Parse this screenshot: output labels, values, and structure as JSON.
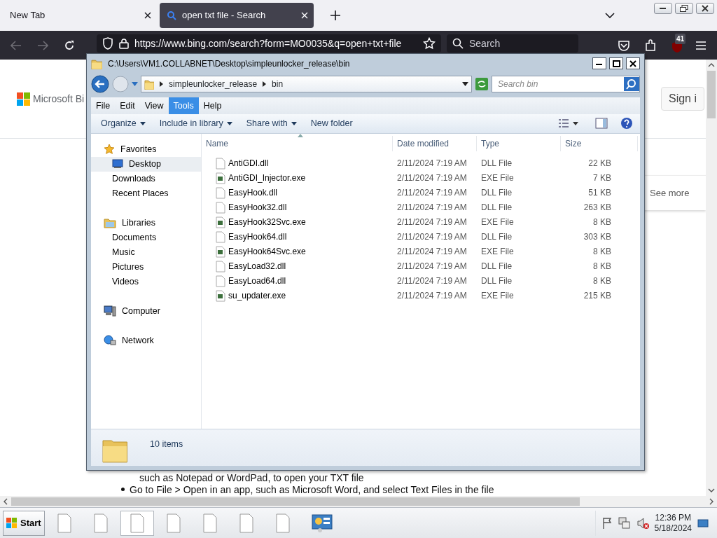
{
  "browser": {
    "tabs": [
      {
        "label": "New Tab",
        "kind": "blank",
        "selected": false
      },
      {
        "label": "open txt file - Search",
        "kind": "search",
        "selected": true
      }
    ],
    "back": {
      "disabled": true
    },
    "forward": {
      "disabled": true
    },
    "url": "https://www.bing.com/search?form=MO0035&q=open+txt+file",
    "search": {
      "placeholder": "Search"
    },
    "extension_badge": "41"
  },
  "page": {
    "logo": "Microsoft Bi",
    "sign_in": "Sign i",
    "see_more": "See more",
    "paragraphs": [
      {
        "text": "such as Notepad or WordPad, to open your TXT file",
        "bullet": false
      },
      {
        "text": "Go to File > Open in an app, such as Microsoft Word, and select Text Files in the file",
        "bullet": true
      }
    ]
  },
  "explorer": {
    "title": "C:\\Users\\VM1.COLLABNET\\Desktop\\simpleunlocker_release\\bin",
    "breadcrumb": [
      "simpleunlocker_release",
      "bin"
    ],
    "search": {
      "placeholder": "Search bin"
    },
    "menu": [
      {
        "label": "File",
        "selected": false
      },
      {
        "label": "Edit",
        "selected": false
      },
      {
        "label": "View",
        "selected": false
      },
      {
        "label": "Tools",
        "selected": true
      },
      {
        "label": "Help",
        "selected": false
      }
    ],
    "commands": [
      {
        "label": "Organize",
        "dropdown": true
      },
      {
        "label": "Include in library",
        "dropdown": true
      },
      {
        "label": "Share with",
        "dropdown": true
      },
      {
        "label": "New folder",
        "dropdown": false
      }
    ],
    "nav": [
      {
        "label": "Favorites",
        "kind": "favorites",
        "selected": false,
        "children": [
          {
            "label": "Desktop",
            "kind": "desktop",
            "selected": true
          },
          {
            "label": "Downloads",
            "kind": "plain",
            "selected": false
          },
          {
            "label": "Recent Places",
            "kind": "plain",
            "selected": false
          }
        ]
      },
      {
        "label": "Libraries",
        "kind": "libraries",
        "selected": false,
        "children": [
          {
            "label": "Documents",
            "kind": "plain",
            "selected": false
          },
          {
            "label": "Music",
            "kind": "plain",
            "selected": false
          },
          {
            "label": "Pictures",
            "kind": "plain",
            "selected": false
          },
          {
            "label": "Videos",
            "kind": "plain",
            "selected": false
          }
        ]
      },
      {
        "label": "Computer",
        "kind": "computer",
        "selected": false
      },
      {
        "label": "Network",
        "kind": "network",
        "selected": false
      }
    ],
    "columns": [
      "Name",
      "Date modified",
      "Type",
      "Size"
    ],
    "files": [
      {
        "name": "AntiGDI.dll",
        "date": "2/11/2024 7:19 AM",
        "type": "DLL File",
        "size": "22 KB",
        "kind": "dll"
      },
      {
        "name": "AntiGDI_Injector.exe",
        "date": "2/11/2024 7:19 AM",
        "type": "EXE File",
        "size": "7 KB",
        "kind": "exe"
      },
      {
        "name": "EasyHook.dll",
        "date": "2/11/2024 7:19 AM",
        "type": "DLL File",
        "size": "51 KB",
        "kind": "dll"
      },
      {
        "name": "EasyHook32.dll",
        "date": "2/11/2024 7:19 AM",
        "type": "DLL File",
        "size": "263 KB",
        "kind": "dll"
      },
      {
        "name": "EasyHook32Svc.exe",
        "date": "2/11/2024 7:19 AM",
        "type": "EXE File",
        "size": "8 KB",
        "kind": "exe"
      },
      {
        "name": "EasyHook64.dll",
        "date": "2/11/2024 7:19 AM",
        "type": "DLL File",
        "size": "303 KB",
        "kind": "dll"
      },
      {
        "name": "EasyHook64Svc.exe",
        "date": "2/11/2024 7:19 AM",
        "type": "EXE File",
        "size": "8 KB",
        "kind": "exe"
      },
      {
        "name": "EasyLoad32.dll",
        "date": "2/11/2024 7:19 AM",
        "type": "DLL File",
        "size": "8 KB",
        "kind": "dll"
      },
      {
        "name": "EasyLoad64.dll",
        "date": "2/11/2024 7:19 AM",
        "type": "DLL File",
        "size": "8 KB",
        "kind": "dll"
      },
      {
        "name": "su_updater.exe",
        "date": "2/11/2024 7:19 AM",
        "type": "EXE File",
        "size": "215 KB",
        "kind": "exe"
      }
    ],
    "status": "10 items"
  },
  "taskbar": {
    "start": "Start",
    "buttons": [
      {
        "kind": "document",
        "selected": false
      },
      {
        "kind": "document",
        "selected": false
      },
      {
        "kind": "document",
        "selected": true
      },
      {
        "kind": "document",
        "selected": false
      },
      {
        "kind": "document",
        "selected": false
      },
      {
        "kind": "document",
        "selected": false
      },
      {
        "kind": "document",
        "selected": false
      },
      {
        "kind": "control-panel",
        "selected": false
      }
    ],
    "time": "12:36 PM",
    "date": "5/18/2024"
  }
}
